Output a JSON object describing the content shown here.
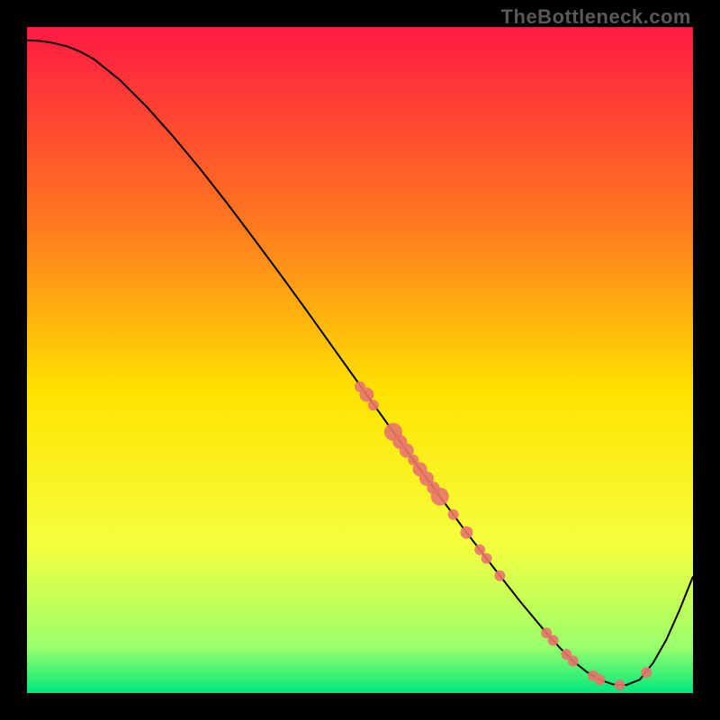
{
  "watermark": "TheBottleneck.com",
  "colors": {
    "dot": "#e8746c",
    "line": "#000000",
    "grad": {
      "top": "#ff1a42",
      "mid_upper": "#ff7a1f",
      "mid": "#ffe300",
      "lower": "#f4ff40",
      "near_bottom": "#9bff6b",
      "bottom": "#00e77e"
    }
  },
  "chart_data": {
    "type": "line",
    "title": "",
    "xlabel": "",
    "ylabel": "",
    "xlim": [
      0,
      100
    ],
    "ylim": [
      0,
      100
    ],
    "series": [
      {
        "name": "curve",
        "x": [
          0,
          2,
          4,
          6,
          8,
          10,
          14,
          18,
          22,
          26,
          30,
          34,
          38,
          42,
          46,
          50,
          54,
          58,
          62,
          66,
          70,
          74,
          76,
          78,
          80,
          82,
          84,
          86,
          88,
          90,
          92,
          94,
          96,
          98,
          100
        ],
        "y": [
          98,
          97.9,
          97.6,
          97.1,
          96.3,
          95.2,
          92.0,
          88.0,
          83.5,
          78.7,
          73.6,
          68.3,
          62.9,
          57.4,
          51.8,
          46.2,
          40.6,
          35.0,
          29.5,
          24.1,
          18.9,
          13.8,
          11.4,
          9.0,
          6.8,
          4.8,
          3.2,
          2.0,
          1.3,
          1.2,
          2.0,
          4.5,
          8.0,
          12.5,
          17.5
        ]
      }
    ],
    "points": [
      {
        "x": 50,
        "y": 46.0,
        "r": 6
      },
      {
        "x": 51,
        "y": 44.8,
        "r": 8
      },
      {
        "x": 52,
        "y": 43.2,
        "r": 6
      },
      {
        "x": 55,
        "y": 39.2,
        "r": 10
      },
      {
        "x": 56,
        "y": 37.7,
        "r": 8
      },
      {
        "x": 57,
        "y": 36.4,
        "r": 8
      },
      {
        "x": 58,
        "y": 35.0,
        "r": 6
      },
      {
        "x": 59,
        "y": 33.6,
        "r": 8
      },
      {
        "x": 60,
        "y": 32.2,
        "r": 8
      },
      {
        "x": 61,
        "y": 30.8,
        "r": 7
      },
      {
        "x": 62,
        "y": 29.5,
        "r": 10
      },
      {
        "x": 64,
        "y": 26.8,
        "r": 6
      },
      {
        "x": 66,
        "y": 24.1,
        "r": 7
      },
      {
        "x": 68,
        "y": 21.5,
        "r": 6
      },
      {
        "x": 69,
        "y": 20.2,
        "r": 6
      },
      {
        "x": 71,
        "y": 17.6,
        "r": 6
      },
      {
        "x": 78,
        "y": 9.0,
        "r": 6
      },
      {
        "x": 79,
        "y": 7.9,
        "r": 6
      },
      {
        "x": 81,
        "y": 5.8,
        "r": 6
      },
      {
        "x": 82,
        "y": 4.8,
        "r": 6
      },
      {
        "x": 85,
        "y": 2.6,
        "r": 6
      },
      {
        "x": 86,
        "y": 2.0,
        "r": 6
      },
      {
        "x": 89,
        "y": 1.2,
        "r": 6
      },
      {
        "x": 93,
        "y": 3.1,
        "r": 6
      }
    ]
  }
}
